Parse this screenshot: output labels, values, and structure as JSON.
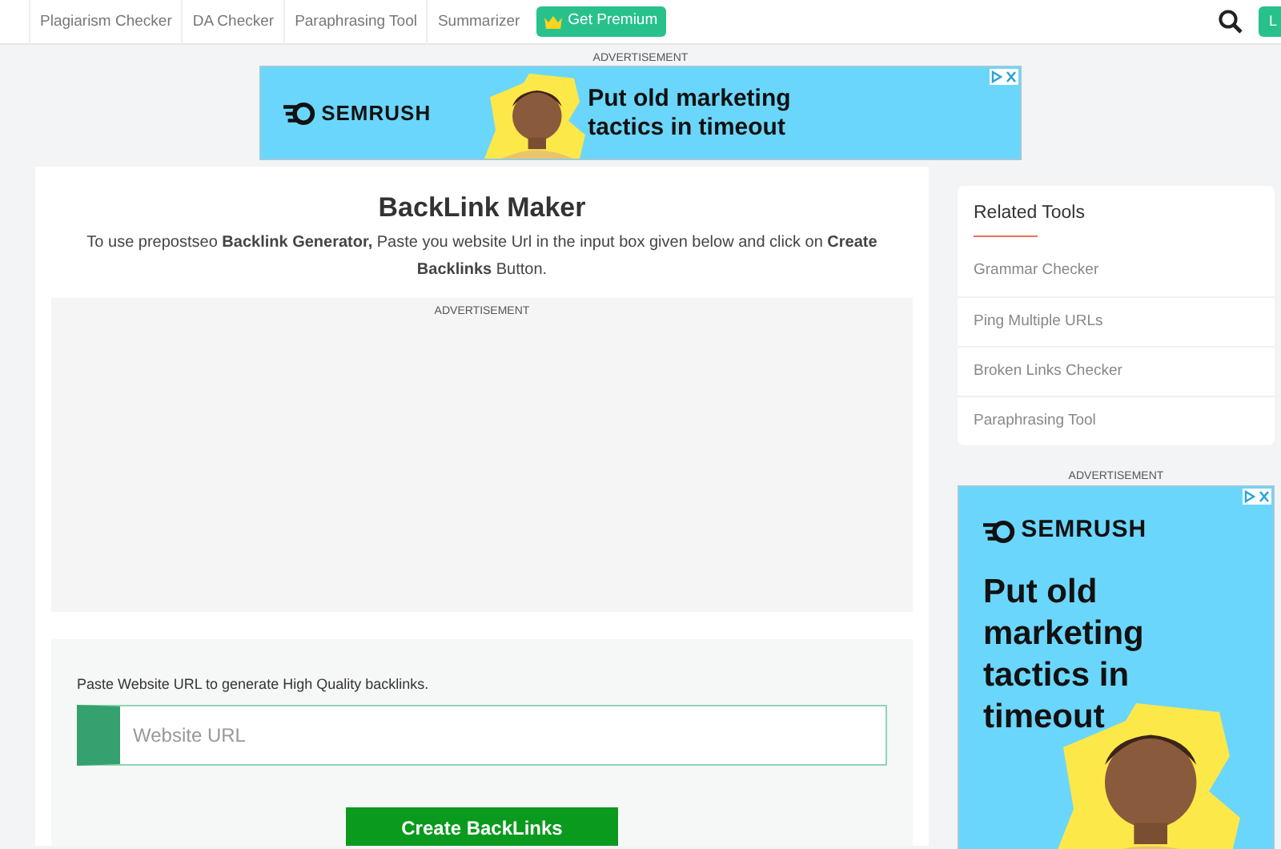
{
  "nav": {
    "items": [
      {
        "label": "Plagiarism Checker"
      },
      {
        "label": "DA Checker"
      },
      {
        "label": "Paraphrasing Tool"
      },
      {
        "label": "Summarizer"
      }
    ],
    "premium": "Get Premium",
    "login": "L"
  },
  "top_ad": {
    "label": "ADVERTISEMENT",
    "brand": "SEMRUSH",
    "headline": "Put old marketing tactics in timeout"
  },
  "main": {
    "title": "BackLink Maker",
    "description": "To use prepostseo **Backlink Generator,** Paste you website Url in the input box given below and click on **Create Backlinks** Button.",
    "ad_label": "ADVERTISEMENT",
    "form_label": "Paste Website URL to generate High Quality backlinks.",
    "url_field": {
      "placeholder": "Website URL"
    },
    "submit": "Create BackLinks"
  },
  "sidebar": {
    "title": "Related Tools",
    "items": [
      {
        "label": "Grammar Checker"
      },
      {
        "label": "Ping Multiple URLs"
      },
      {
        "label": "Broken Links Checker"
      },
      {
        "label": "Paraphrasing Tool"
      }
    ]
  },
  "side_ad": {
    "label": "ADVERTISEMENT",
    "brand": "SEMRUSH",
    "headline": "Put old marketing tactics in timeout"
  }
}
